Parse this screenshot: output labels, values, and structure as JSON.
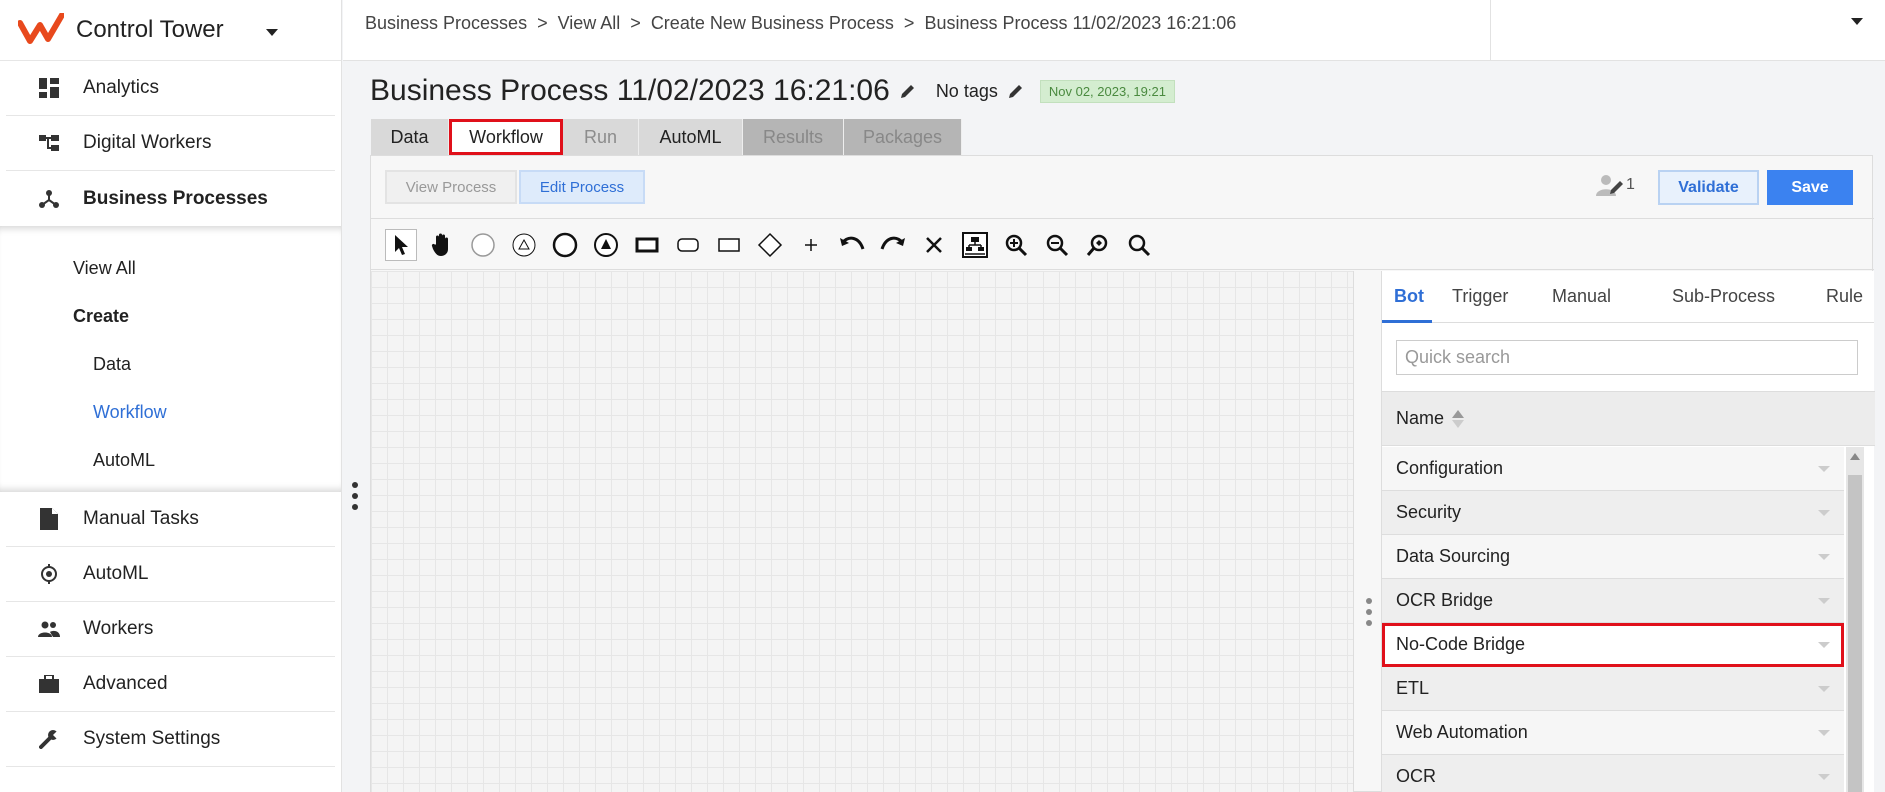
{
  "app": {
    "name": "Control Tower"
  },
  "sidebar": {
    "items": [
      {
        "label": "Analytics",
        "icon": "dashboard-icon"
      },
      {
        "label": "Digital Workers",
        "icon": "hierarchy-icon"
      },
      {
        "label": "Business Processes",
        "icon": "process-icon",
        "active": true
      },
      {
        "label": "Manual Tasks",
        "icon": "document-icon"
      },
      {
        "label": "AutoML",
        "icon": "automl-icon"
      },
      {
        "label": "Workers",
        "icon": "people-icon"
      },
      {
        "label": "Advanced",
        "icon": "briefcase-icon"
      },
      {
        "label": "System Settings",
        "icon": "wrench-icon"
      }
    ],
    "submenu": {
      "view_all": "View All",
      "create": "Create",
      "data": "Data",
      "workflow": "Workflow",
      "automl": "AutoML"
    }
  },
  "breadcrumb": [
    "Business Processes",
    "View All",
    "Create New Business Process",
    "Business Process 11/02/2023 16:21:06"
  ],
  "page": {
    "title": "Business Process 11/02/2023 16:21:06",
    "tags": "No tags",
    "date_badge": "Nov 02, 2023, 19:21"
  },
  "tabs": {
    "data": "Data",
    "workflow": "Workflow",
    "run": "Run",
    "automl": "AutoML",
    "results": "Results",
    "packages": "Packages",
    "active": "Workflow"
  },
  "actions": {
    "view_process": "View Process",
    "edit_process": "Edit Process",
    "collaborators_count": "1",
    "validate": "Validate",
    "save": "Save"
  },
  "toolbar": {
    "tools": [
      "pointer-icon",
      "hand-icon",
      "start-event-icon",
      "start-event-triangle-icon",
      "end-event-icon",
      "end-event-triangle-icon",
      "task-icon",
      "rounded-task-icon",
      "subprocess-icon",
      "gateway-icon",
      "add-icon",
      "undo-icon",
      "redo-icon",
      "delete-icon",
      "auto-layout-icon",
      "zoom-in-icon",
      "zoom-out-icon",
      "zoom-fit-icon",
      "zoom-reset-icon"
    ]
  },
  "palette": {
    "tabs": [
      "Bot",
      "Trigger",
      "Manual",
      "Sub-Process",
      "Rule"
    ],
    "active_tab": "Bot",
    "search_placeholder": "Quick search",
    "column_header": "Name",
    "rows": [
      "Configuration",
      "Security",
      "Data Sourcing",
      "OCR Bridge",
      "No-Code Bridge",
      "ETL",
      "Web Automation",
      "OCR"
    ],
    "highlighted_row": "No-Code Bridge"
  },
  "colors": {
    "accent": "#2f6fd6",
    "save_button": "#3b82f0",
    "highlight_outline": "#e0101a",
    "brand": "#e8491d",
    "badge_bg": "#d4edd0"
  }
}
